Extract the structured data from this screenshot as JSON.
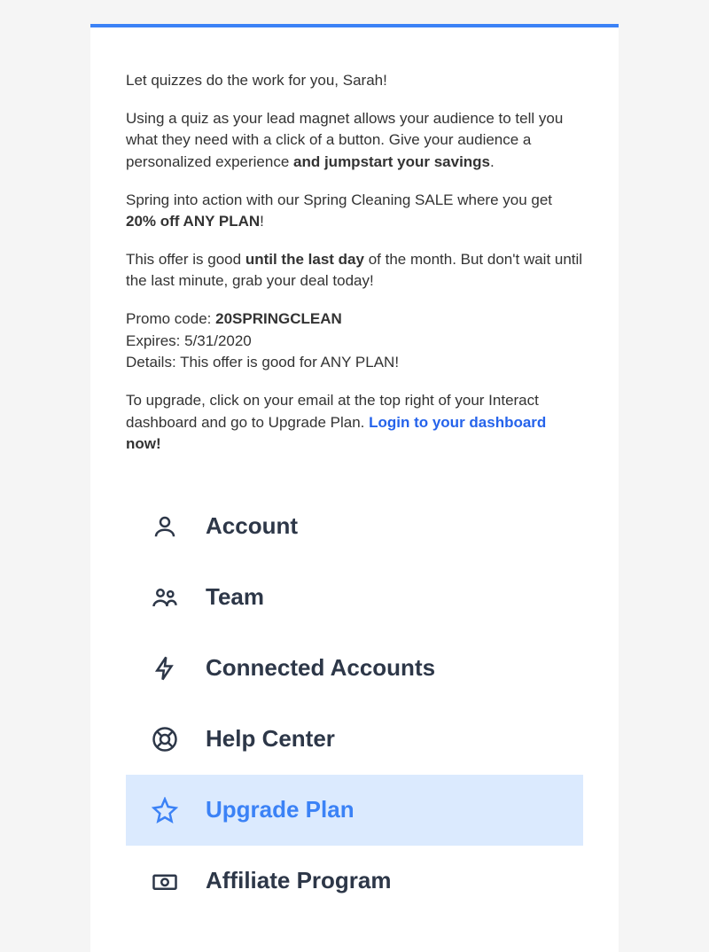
{
  "greeting": "Let quizzes do the work for you, Sarah!",
  "p1_a": "Using a quiz as your lead magnet allows your audience to tell you what they need with a click of a button. Give your audience a personalized experience ",
  "p1_b": "and jumpstart your savings",
  "p1_c": ".",
  "p2_a": "Spring into action with our Spring Cleaning SALE where you get ",
  "p2_b": "20% off ANY PLAN",
  "p2_c": "!",
  "p3_a": "This offer is good ",
  "p3_b": "until the last day",
  "p3_c": " of the month. But don't wait until the last minute, grab your deal today!",
  "promo_label": "Promo code: ",
  "promo_code": "20SPRINGCLEAN",
  "expires": "Expires: 5/31/2020",
  "details": "Details: This offer is good for ANY PLAN!",
  "p4_a": "To upgrade, click on your email at the top right of your Interact dashboard and go to Upgrade Plan. ",
  "p4_link": "Login to your dashboard",
  "p4_b": " now!",
  "menu": {
    "account": "Account",
    "team": "Team",
    "connected": "Connected Accounts",
    "help": "Help Center",
    "upgrade": "Upgrade Plan",
    "affiliate": "Affiliate Program"
  }
}
